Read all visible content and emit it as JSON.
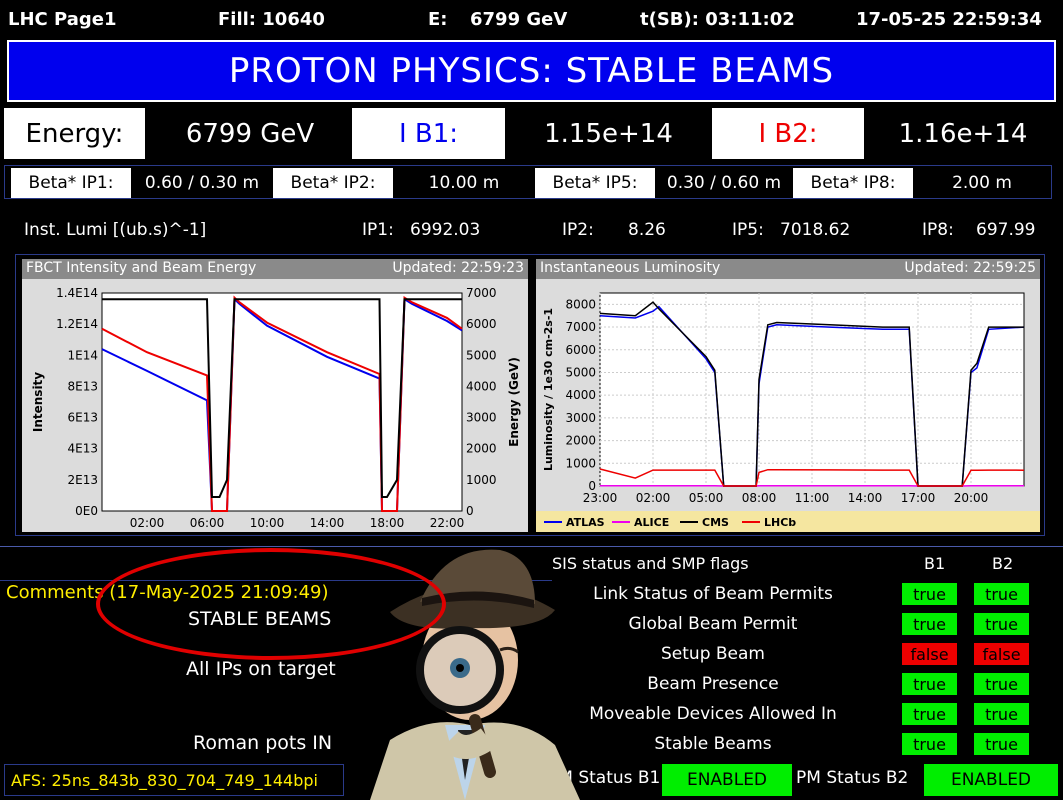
{
  "header": {
    "page": "LHC Page1",
    "fill": "Fill: 10640",
    "energy_label": "E:",
    "energy_value": "6799 GeV",
    "tsb": "t(SB): 03:11:02",
    "datetime": "17-05-25 22:59:34"
  },
  "banner": "PROTON PHYSICS: STABLE BEAMS",
  "beam_row": {
    "energy_label": "Energy:",
    "energy_value": "6799 GeV",
    "ib1_label": "I B1:",
    "ib1_value": "1.15e+14",
    "ib2_label": "I B2:",
    "ib2_value": "1.16e+14"
  },
  "beta": [
    {
      "label": "Beta* IP1:",
      "value": "0.60 / 0.30 m"
    },
    {
      "label": "Beta* IP2:",
      "value": "10.00 m"
    },
    {
      "label": "Beta* IP5:",
      "value": "0.30 / 0.60 m"
    },
    {
      "label": "Beta* IP8:",
      "value": "2.00 m"
    }
  ],
  "lumi": {
    "label": "Inst. Lumi [(ub.s)^-1]",
    "ip1_label": "IP1:",
    "ip1": "6992.03",
    "ip2_label": "IP2:",
    "ip2": "8.26",
    "ip5_label": "IP5:",
    "ip5": "7018.62",
    "ip8_label": "IP8:",
    "ip8": "697.99"
  },
  "plot_fbct": {
    "title": "FBCT Intensity and Beam Energy",
    "updated": "Updated: 22:59:23",
    "ylabel": "Intensity",
    "y2label": "Energy (GeV)",
    "yticks": [
      "0E0",
      "2E13",
      "4E13",
      "6E13",
      "8E13",
      "1E14",
      "1.2E14",
      "1.4E14"
    ],
    "y2ticks": [
      "0",
      "1000",
      "2000",
      "3000",
      "4000",
      "5000",
      "6000",
      "7000"
    ],
    "xticks": [
      "02:00",
      "06:00",
      "10:00",
      "14:00",
      "18:00",
      "22:00"
    ]
  },
  "plot_lumi": {
    "title": "Instantaneous Luminosity",
    "updated": "Updated: 22:59:25",
    "ylabel": "Luminosity / 1e30 cm-2s-1",
    "yticks": [
      "0",
      "1000",
      "2000",
      "3000",
      "4000",
      "5000",
      "6000",
      "7000",
      "8000"
    ],
    "xticks": [
      "23:00",
      "02:00",
      "05:00",
      "08:00",
      "11:00",
      "14:00",
      "17:00",
      "20:00"
    ],
    "legend": [
      "ATLAS",
      "ALICE",
      "CMS",
      "LHCb"
    ]
  },
  "chart_data": [
    {
      "type": "line",
      "title": "FBCT Intensity and Beam Energy",
      "xlabel": "",
      "ylabel": "Intensity",
      "y2label": "Energy (GeV)",
      "x": [
        "23:00",
        "02:00",
        "06:00",
        "06:20",
        "06:50",
        "07:20",
        "07:50",
        "08:10",
        "10:00",
        "14:00",
        "17:30",
        "17:40",
        "18:00",
        "18:40",
        "19:10",
        "19:40",
        "22:00",
        "23:00"
      ],
      "series": [
        {
          "name": "",
          "color": "#0000ee",
          "values": [
            104000000000000.0,
            90000000000000.0,
            71000000000000.0,
            0,
            0,
            0,
            136000000000000.0,
            133000000000000.0,
            119000000000000.0,
            99000000000000.0,
            85000000000000.0,
            0,
            0,
            0,
            136000000000000.0,
            133000000000000.0,
            122000000000000.0,
            116000000000000.0
          ]
        },
        {
          "name": "",
          "color": "#ee0000",
          "values": [
            117000000000000.0,
            102000000000000.0,
            87000000000000.0,
            0,
            0,
            0,
            137000000000000.0,
            134000000000000.0,
            121000000000000.0,
            102000000000000.0,
            88000000000000.0,
            0,
            0,
            0,
            137000000000000.0,
            134000000000000.0,
            124000000000000.0,
            117000000000000.0
          ]
        },
        {
          "name": "",
          "color": "#000000",
          "axis": "y2",
          "values": [
            6799,
            6799,
            6799,
            450,
            450,
            1000,
            6799,
            6799,
            6799,
            6799,
            6799,
            450,
            450,
            1000,
            6799,
            6799,
            6799,
            6799
          ]
        }
      ],
      "ylim": [
        0,
        140000000000000.0
      ],
      "y2lim": [
        0,
        7000
      ]
    },
    {
      "type": "line",
      "title": "Instantaneous Luminosity",
      "ylabel": "Luminosity / 1e30 cm-2s-1",
      "x": [
        "23:00",
        "01:00",
        "02:00",
        "02:20",
        "05:00",
        "05:30",
        "06:00",
        "07:00",
        "07:50",
        "08:00",
        "08:30",
        "09:00",
        "12:00",
        "15:00",
        "16:30",
        "17:00",
        "17:20",
        "18:00",
        "19:30",
        "20:00",
        "20:20",
        "21:00",
        "23:00"
      ],
      "series": [
        {
          "name": "ATLAS",
          "color": "#0000ee",
          "values": [
            7500,
            7400,
            7700,
            7900,
            5600,
            5000,
            0,
            0,
            0,
            4500,
            7000,
            7100,
            7000,
            6900,
            6900,
            0,
            0,
            0,
            0,
            5000,
            5200,
            6900,
            7000
          ]
        },
        {
          "name": "ALICE",
          "color": "#ee00ee",
          "values": [
            10,
            10,
            10,
            10,
            10,
            10,
            0,
            0,
            0,
            10,
            10,
            10,
            10,
            10,
            10,
            0,
            0,
            0,
            0,
            10,
            10,
            10,
            10
          ]
        },
        {
          "name": "CMS",
          "color": "#000000",
          "values": [
            7600,
            7500,
            8100,
            7800,
            5700,
            5100,
            0,
            0,
            0,
            4700,
            7100,
            7200,
            7100,
            7000,
            7000,
            0,
            0,
            0,
            0,
            5100,
            5400,
            7000,
            7000
          ]
        },
        {
          "name": "LHCb",
          "color": "#ee0000",
          "values": [
            750,
            350,
            700,
            700,
            700,
            700,
            0,
            0,
            0,
            600,
            720,
            720,
            710,
            700,
            700,
            0,
            0,
            0,
            0,
            690,
            690,
            700,
            698
          ]
        }
      ],
      "ylim": [
        0,
        8500
      ],
      "grid": true,
      "legend": "bottom"
    }
  ],
  "sis": {
    "title": "SIS status and SMP flags",
    "b1": "B1",
    "b2": "B2",
    "flags": [
      {
        "label": "Link Status of Beam Permits",
        "b1": "true",
        "b2": "true"
      },
      {
        "label": "Global Beam Permit",
        "b1": "true",
        "b2": "true"
      },
      {
        "label": "Setup Beam",
        "b1": "false",
        "b2": "false"
      },
      {
        "label": "Beam Presence",
        "b1": "true",
        "b2": "true"
      },
      {
        "label": "Moveable Devices Allowed In",
        "b1": "true",
        "b2": "true"
      },
      {
        "label": "Stable Beams",
        "b1": "true",
        "b2": "true"
      }
    ]
  },
  "comments": {
    "header": "Comments (17-May-2025 21:09:49)",
    "line1": "STABLE BEAMS",
    "line2": "All IPs on target",
    "line3": "Roman pots IN"
  },
  "footer": {
    "afs": "AFS: 25ns_843b_830_704_749_144bpi",
    "pm_b1_label": "PM Status B1",
    "pm_b1": "ENABLED",
    "pm_b2_label": "PM Status B2",
    "pm_b2": "ENABLED"
  }
}
